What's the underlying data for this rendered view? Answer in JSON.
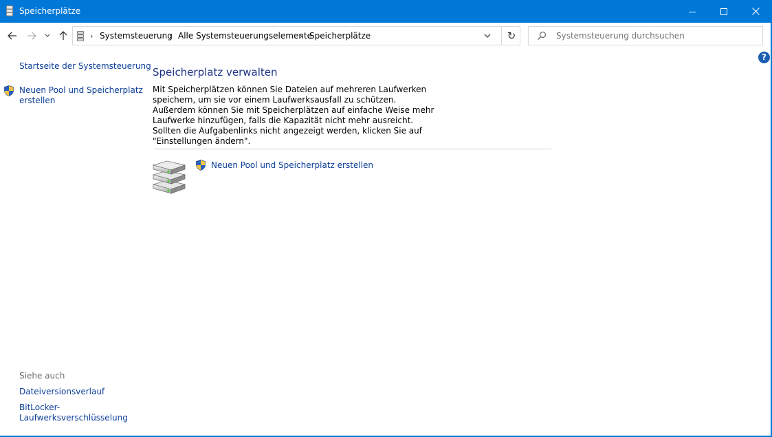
{
  "window": {
    "title": "Speicherplätze"
  },
  "address_bar": {
    "crumbs": [
      "Systemsteuerung",
      "Alle Systemsteuerungselemente",
      "Speicherplätze"
    ],
    "separator": "›"
  },
  "search": {
    "placeholder": "Systemsteuerung durchsuchen"
  },
  "sidebar": {
    "home_link": "Startseite der Systemsteuerung",
    "new_pool_link_line1": "Neuen Pool und Speicherplatz",
    "new_pool_link_line2": "erstellen",
    "see_also": "Siehe auch",
    "file_history": "Dateiversionsverlauf",
    "bitlocker_line1": "BitLocker-",
    "bitlocker_line2": "Laufwerksverschlüsselung"
  },
  "main": {
    "heading": "Speicherplatz verwalten",
    "description": "Mit Speicherplätzen können Sie Dateien auf mehreren Laufwerken speichern, um sie vor einem Laufwerksausfall zu schützen. Außerdem können Sie mit Speicherplätzen auf einfache Weise mehr Laufwerke hinzufügen, falls die Kapazität nicht mehr ausreicht. Sollten die Aufgabenlinks nicht angezeigt werden, klicken Sie auf \"Einstellungen ändern\".",
    "task_link": "Neuen Pool und Speicherplatz erstellen"
  },
  "help": {
    "label": "?"
  },
  "colors": {
    "titlebar": "#0078d7",
    "link": "#0b3e9a",
    "heading": "#1e3287"
  },
  "icons": {
    "app": "storage-spaces-icon",
    "shield": "uac-shield-icon",
    "drives": "drive-stack-icon"
  }
}
